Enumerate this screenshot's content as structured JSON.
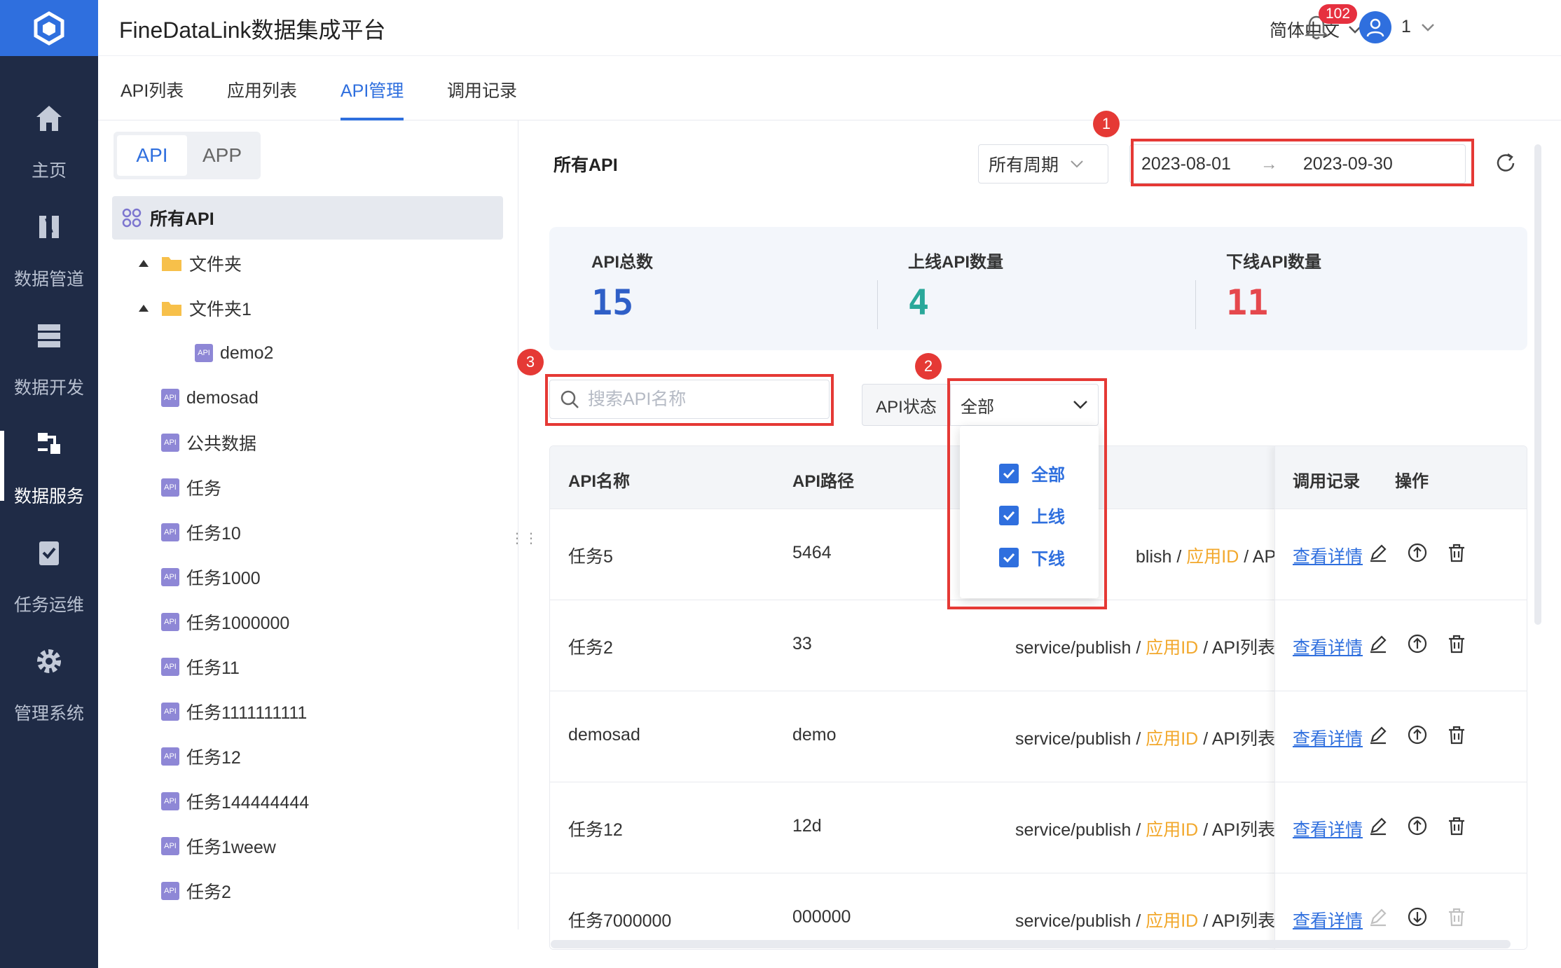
{
  "sidebar": {
    "items": [
      {
        "label": "主页",
        "icon": "home-icon"
      },
      {
        "label": "数据管道",
        "icon": "pipeline-icon"
      },
      {
        "label": "数据开发",
        "icon": "develop-icon"
      },
      {
        "label": "数据服务",
        "icon": "service-icon",
        "active": true
      },
      {
        "label": "任务运维",
        "icon": "task-icon"
      },
      {
        "label": "管理系统",
        "icon": "gear-icon"
      }
    ]
  },
  "header": {
    "title": "FineDataLink数据集成平台",
    "language": "简体中文",
    "notifications": "102",
    "user": "1"
  },
  "tabs": [
    "API列表",
    "应用列表",
    "API管理",
    "调用记录"
  ],
  "tree": {
    "segment": [
      "API",
      "APP"
    ],
    "root": "所有API",
    "folders": [
      "文件夹",
      "文件夹1"
    ],
    "nodes": [
      "demo2",
      "demosad",
      "公共数据",
      "任务",
      "任务10",
      "任务1000",
      "任务1000000",
      "任务11",
      "任务1111111111",
      "任务12",
      "任务144444444",
      "任务1weew",
      "任务2"
    ],
    "api_tag": "API"
  },
  "main": {
    "title": "所有API",
    "period": "所有周期",
    "date_start": "2023-08-01",
    "date_end": "2023-09-30",
    "date_arrow": "→",
    "stats": [
      {
        "label": "API总数",
        "value": "15",
        "color": "#2f5fc7"
      },
      {
        "label": "上线API数量",
        "value": "4",
        "color": "#2aa89a"
      },
      {
        "label": "下线API数量",
        "value": "11",
        "color": "#e5484d"
      }
    ],
    "search_placeholder": "搜索API名称",
    "status_label": "API状态",
    "status_value": "全部",
    "status_options": [
      "全部",
      "上线",
      "下线"
    ],
    "markers": [
      "1",
      "2",
      "3"
    ]
  },
  "table": {
    "headers": [
      "API名称",
      "API路径",
      "调用记录",
      "操作"
    ],
    "detail_link": "查看详情",
    "path_prefix": "service/publish",
    "path_sep": "/",
    "path_app": "应用ID",
    "path_tail": "API列表",
    "first_row_path": "blish",
    "rows": [
      {
        "name": "任务5",
        "path": "5464"
      },
      {
        "name": "任务2",
        "path": "33"
      },
      {
        "name": "demosad",
        "path": "demo"
      },
      {
        "name": "任务12",
        "path": "12d"
      },
      {
        "name": "任务7000000",
        "path": "000000"
      }
    ]
  }
}
